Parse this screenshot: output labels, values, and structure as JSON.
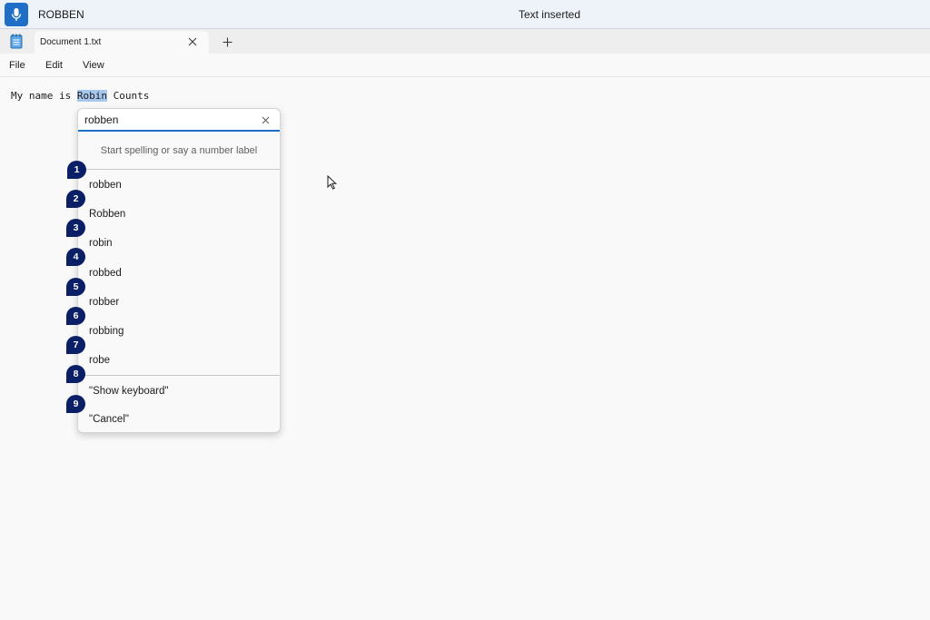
{
  "voice_access": {
    "recognized_word": "ROBBEN",
    "status": "Text inserted",
    "mic_icon": "microphone-icon"
  },
  "tabs": [
    {
      "title": "Document 1.txt",
      "active": true
    }
  ],
  "menu": {
    "file": "File",
    "edit": "Edit",
    "view": "View"
  },
  "editor": {
    "before": "My name is ",
    "selected": "Robin",
    "after": " Counts"
  },
  "spelling_popup": {
    "input_value": "robben",
    "hint": "Start spelling or say a number label",
    "suggestions": [
      {
        "number": "1",
        "label": "robben"
      },
      {
        "number": "2",
        "label": "Robben"
      },
      {
        "number": "3",
        "label": "robin"
      },
      {
        "number": "4",
        "label": "robbed"
      },
      {
        "number": "5",
        "label": "robber"
      },
      {
        "number": "6",
        "label": "robbing"
      },
      {
        "number": "7",
        "label": "robe"
      }
    ],
    "commands": [
      {
        "number": "8",
        "label": "\"Show keyboard\""
      },
      {
        "number": "9",
        "label": "\"Cancel\""
      }
    ]
  },
  "colors": {
    "accent": "#1f6fc6",
    "badge": "#0a1f66",
    "selection": "#a7c7ee"
  }
}
